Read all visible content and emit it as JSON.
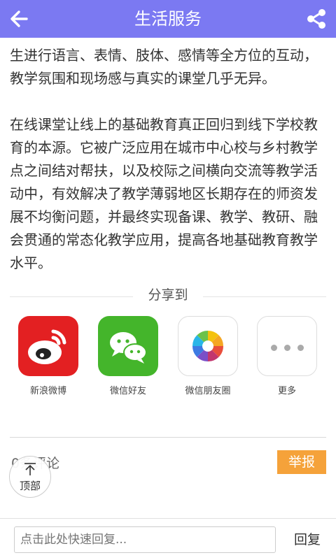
{
  "header": {
    "title": "生活服务",
    "back_icon": "back-arrow-icon",
    "share_icon": "share-icon",
    "bg_color": "#7b79f2"
  },
  "article": {
    "paragraphs": [
      "生进行语言、表情、肢体、感情等全方位的互动，教学氛围和现场感与真实的课堂几乎无异。",
      "在线课堂让线上的基础教育真正回归到线下学校教育的本源。它被广泛应用在城市中心校与乡村教学点之间结对帮扶，以及校际之间横向交流等教学活动中，有效解决了教学薄弱地区长期存在的师资发展不均衡问题，并最终实现备课、教学、教研、融会贯通的常态化教学应用，提高各地基础教育教学水平。"
    ]
  },
  "share": {
    "label": "分享到",
    "items": [
      {
        "label": "新浪微博",
        "icon": "weibo-icon",
        "color": "#e32022"
      },
      {
        "label": "微信好友",
        "icon": "wechat-icon",
        "color": "#44b52b"
      },
      {
        "label": "微信朋友圈",
        "icon": "moments-icon"
      },
      {
        "label": "更多",
        "icon": "more-icon"
      }
    ]
  },
  "comments": {
    "count_text": "0条评论",
    "report_label": "举报",
    "report_color": "#f5a23a"
  },
  "to_top": {
    "label": "顶部",
    "icon": "arrow-up-icon"
  },
  "footer": {
    "placeholder": "点击此处快速回复...",
    "reply_label": "回复"
  }
}
